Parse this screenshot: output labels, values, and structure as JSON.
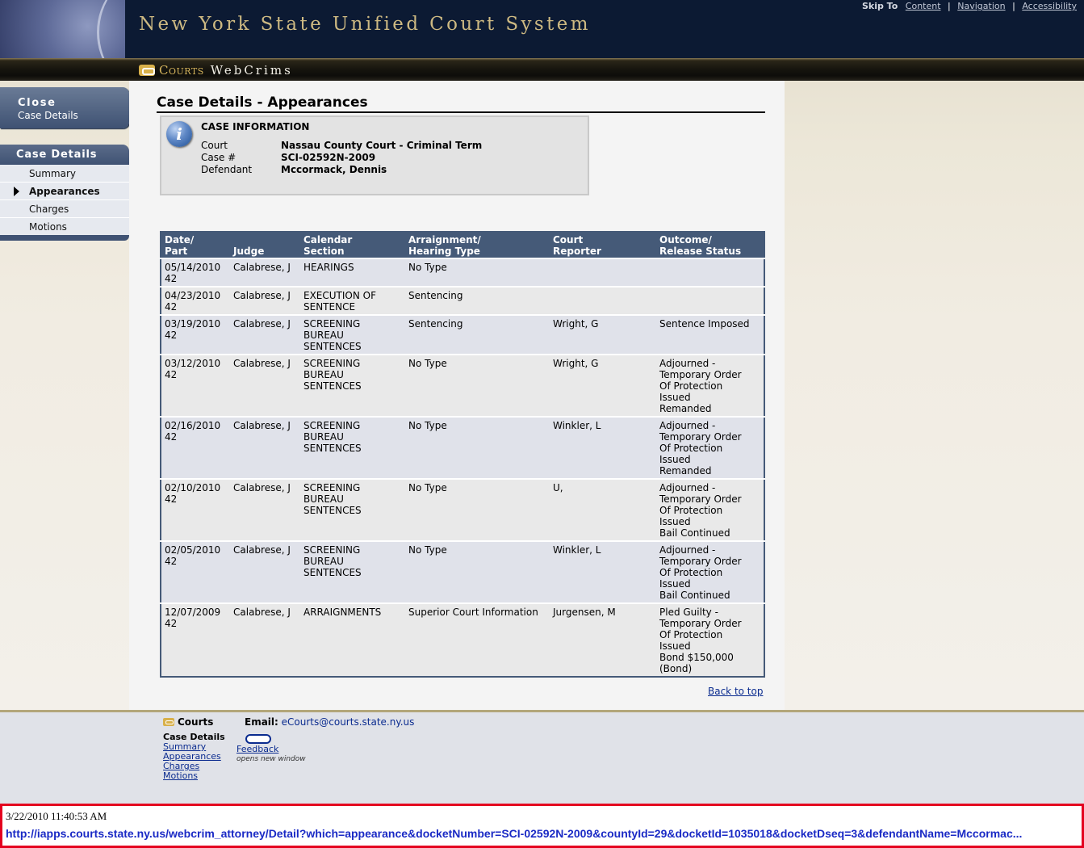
{
  "header": {
    "site_title": "New York State Unified Court System",
    "skip_label": "Skip To",
    "skip_links": [
      "Content",
      "Navigation",
      "Accessibility"
    ],
    "logo_courts": "Courts",
    "logo_app": "WebCrims"
  },
  "sidebar": {
    "close_big": "Close",
    "close_small": "Case Details",
    "section_title": "Case Details",
    "items": [
      {
        "label": "Summary",
        "active": false
      },
      {
        "label": "Appearances",
        "active": true
      },
      {
        "label": "Charges",
        "active": false
      },
      {
        "label": "Motions",
        "active": false
      }
    ]
  },
  "main": {
    "page_title": "Case Details - Appearances",
    "info": {
      "heading": "CASE INFORMATION",
      "court_label": "Court",
      "court_value": "Nassau County Court - Criminal Term",
      "case_label": "Case #",
      "case_value": "SCI-02592N-2009",
      "defendant_label": "Defendant",
      "defendant_value": "Mccormack, Dennis"
    },
    "table": {
      "headers": [
        [
          "Date/",
          "Part"
        ],
        [
          "",
          "Judge"
        ],
        [
          "Calendar",
          "Section"
        ],
        [
          "Arraignment/",
          "Hearing Type"
        ],
        [
          "Court",
          "Reporter"
        ],
        [
          "Outcome/",
          "Release Status"
        ]
      ],
      "rows": [
        {
          "date": "05/14/2010",
          "part": "42",
          "judge": "Calabrese, J",
          "section": [
            "HEARINGS"
          ],
          "type": "No Type",
          "reporter": "",
          "outcome": []
        },
        {
          "date": "04/23/2010",
          "part": "42",
          "judge": "Calabrese, J",
          "section": [
            "EXECUTION OF",
            "SENTENCE"
          ],
          "type": "Sentencing",
          "reporter": "",
          "outcome": []
        },
        {
          "date": "03/19/2010",
          "part": "42",
          "judge": "Calabrese, J",
          "section": [
            "SCREENING",
            "BUREAU",
            "SENTENCES"
          ],
          "type": "Sentencing",
          "reporter": "Wright, G",
          "outcome": [
            "Sentence Imposed"
          ]
        },
        {
          "date": "03/12/2010",
          "part": "42",
          "judge": "Calabrese, J",
          "section": [
            "SCREENING",
            "BUREAU",
            "SENTENCES"
          ],
          "type": "No Type",
          "reporter": "Wright, G",
          "outcome": [
            "Adjourned -",
            "Temporary Order",
            "Of Protection",
            "Issued",
            "Remanded"
          ]
        },
        {
          "date": "02/16/2010",
          "part": "42",
          "judge": "Calabrese, J",
          "section": [
            "SCREENING",
            "BUREAU",
            "SENTENCES"
          ],
          "type": "No Type",
          "reporter": "Winkler, L",
          "outcome": [
            "Adjourned -",
            "Temporary Order",
            "Of Protection",
            "Issued",
            "Remanded"
          ]
        },
        {
          "date": "02/10/2010",
          "part": "42",
          "judge": "Calabrese, J",
          "section": [
            "SCREENING",
            "BUREAU",
            "SENTENCES"
          ],
          "type": "No Type",
          "reporter": "U,",
          "outcome": [
            "Adjourned -",
            "Temporary Order",
            "Of Protection",
            "Issued",
            "Bail Continued"
          ]
        },
        {
          "date": "02/05/2010",
          "part": "42",
          "judge": "Calabrese, J",
          "section": [
            "SCREENING",
            "BUREAU",
            "SENTENCES"
          ],
          "type": "No Type",
          "reporter": "Winkler, L",
          "outcome": [
            "Adjourned -",
            "Temporary Order",
            "Of Protection",
            "Issued",
            "Bail Continued"
          ]
        },
        {
          "date": "12/07/2009",
          "part": "42",
          "judge": "Calabrese, J",
          "section": [
            "ARRAIGNMENTS"
          ],
          "type": "Superior Court Information",
          "reporter": "Jurgensen, M",
          "outcome": [
            "Pled Guilty -",
            "Temporary Order",
            "Of Protection",
            "Issued",
            "Bond $150,000",
            "(Bond)"
          ]
        }
      ]
    },
    "back_to_top": "Back to top"
  },
  "footer": {
    "logo_text": "Courts",
    "email_label": "Email:",
    "email_value": "eCourts@courts.state.ny.us",
    "case_details_title": "Case Details",
    "links": [
      "Summary",
      "Appearances",
      "Charges",
      "Motions"
    ],
    "feedback_label": "Feedback",
    "feedback_note": "opens new window"
  },
  "printbox": {
    "date": "3/22/2010 11:40:53 AM",
    "url": "http://iapps.courts.state.ny.us/webcrim_attorney/Detail?which=appearance&docketNumber=SCI-02592N-2009&countyId=29&docketId=1035018&docketDseq=3&defendantName=Mccormac..."
  }
}
